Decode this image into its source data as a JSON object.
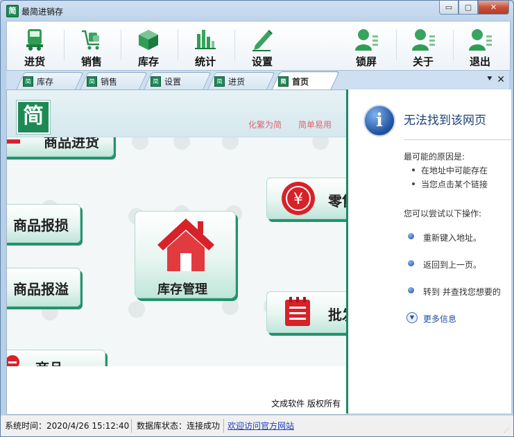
{
  "window": {
    "title": "最简进销存",
    "icon_char": "简",
    "min_glyph": "▭",
    "max_glyph": "▢",
    "close_glyph": "✕"
  },
  "toolbar": {
    "items": [
      {
        "label": "进货",
        "icon": "truck-icon"
      },
      {
        "label": "销售",
        "icon": "cart-icon"
      },
      {
        "label": "库存",
        "icon": "box-icon"
      },
      {
        "label": "统计",
        "icon": "bar-chart-icon"
      },
      {
        "label": "设置",
        "icon": "pencil-icon"
      },
      {
        "label": "锁屏",
        "icon": "user-lock-icon"
      },
      {
        "label": "关于",
        "icon": "user-info-icon"
      },
      {
        "label": "退出",
        "icon": "user-exit-icon"
      }
    ]
  },
  "tabs": {
    "items": [
      {
        "label": "库存"
      },
      {
        "label": "销售"
      },
      {
        "label": "设置"
      },
      {
        "label": "进货"
      },
      {
        "label": "首页"
      }
    ],
    "active": "首页",
    "menu_glyph": "⯆",
    "close_glyph": "✕"
  },
  "home": {
    "logo_char": "简",
    "slogan_left": "化繁为简",
    "slogan_right": "简单易用",
    "buttons": {
      "purchase": "商品进货",
      "loss": "商品报损",
      "overflow": "商品报溢",
      "inventory": "库存管理",
      "retail": "零售",
      "wholesale": "批发",
      "bottom_partial": "商品"
    },
    "copyright": "文成软件  版权所有"
  },
  "browser_error": {
    "title": "无法找到该网页",
    "cause_heading": "最可能的原因是:",
    "causes": [
      "在地址中可能存在",
      "当您点击某个链接"
    ],
    "action_heading": "您可以尝试以下操作:",
    "actions": [
      "重新键入地址。",
      "返回到上一页。",
      "转到  并查找您想要的"
    ],
    "more_info": "更多信息"
  },
  "status": {
    "time": "系统时间：2020/4/26 15:12:40",
    "db": "数据库状态：连接成功",
    "link": "欢迎访问官方网站"
  },
  "colors": {
    "accent_green": "#1d8a55",
    "retail_red": "#d7222a",
    "slogan_pink": "#e0646f",
    "link_blue": "#1a3fb6"
  }
}
